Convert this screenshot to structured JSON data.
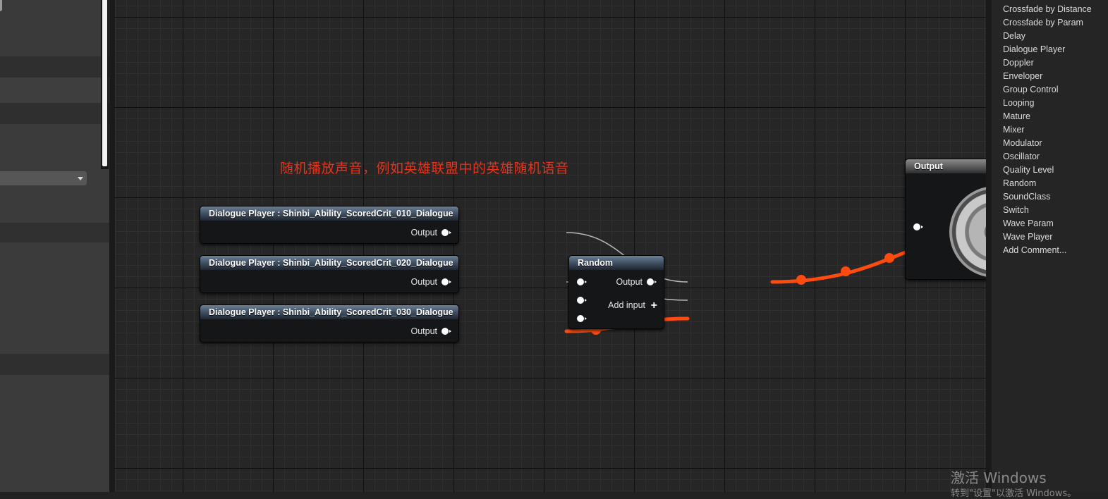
{
  "annotation": "随机播放声音，例如英雄联盟中的英雄随机语音",
  "nodes": {
    "dialogue_1": {
      "title": "Dialogue Player : Shinbi_Ability_ScoredCrit_010_Dialogue",
      "output_label": "Output"
    },
    "dialogue_2": {
      "title": "Dialogue Player : Shinbi_Ability_ScoredCrit_020_Dialogue",
      "output_label": "Output"
    },
    "dialogue_3": {
      "title": "Dialogue Player : Shinbi_Ability_ScoredCrit_030_Dialogue",
      "output_label": "Output"
    },
    "random": {
      "title": "Random",
      "output_label": "Output",
      "add_input_label": "Add input"
    },
    "output": {
      "title": "Output"
    }
  },
  "palette": {
    "items": [
      "Crossfade by Distance",
      "Crossfade by Param",
      "Delay",
      "Dialogue Player",
      "Doppler",
      "Enveloper",
      "Group Control",
      "Looping",
      "Mature",
      "Mixer",
      "Modulator",
      "Oscillator",
      "Quality Level",
      "Random",
      "SoundClass",
      "Switch",
      "Wave Param",
      "Wave Player",
      "Add Comment..."
    ]
  },
  "watermark": {
    "title": "激活 Windows",
    "subtitle": "转到\"设置\"以激活 Windows。"
  },
  "colors": {
    "active_wire": "#ff4a10",
    "idle_wire": "#b8b8b8",
    "annotation": "#e8321a"
  }
}
